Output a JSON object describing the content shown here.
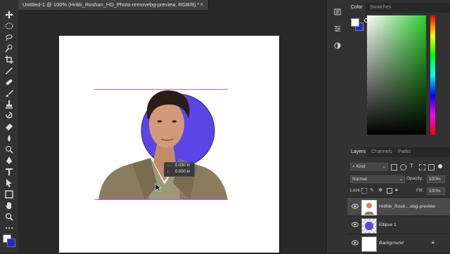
{
  "document": {
    "tab_title": "Untitled-1 @ 100% (Hritik_Roshan_HD_Photo-removebg-preview, RGB/8) *",
    "close_glyph": "×"
  },
  "transform_readout": {
    "x": "0.030 in",
    "y": "0.000 in"
  },
  "color_panel": {
    "tabs": [
      "Color",
      "Swatches"
    ],
    "foreground": "#ffffff",
    "background": "#1a2ad8"
  },
  "layers_panel": {
    "tabs": [
      "Layers",
      "Channels",
      "Paths"
    ],
    "filter_kind": "Kind",
    "blend_mode": "Normal",
    "opacity_label": "Opacity:",
    "opacity_value": "100%",
    "lock_label": "Lock:",
    "fill_label": "Fill:",
    "fill_value": "100%",
    "layers": [
      {
        "name": "Hrithik_Rosh....ebg-preview",
        "selected": true
      },
      {
        "name": "Ellipse 1",
        "selected": false
      },
      {
        "name": "Background",
        "selected": false,
        "italic": true
      }
    ]
  },
  "colors": {
    "ellipse": "#5b45e6",
    "guide": "#e54be5",
    "suit": "#8a7c5e",
    "shirt": "#9c9a78"
  }
}
